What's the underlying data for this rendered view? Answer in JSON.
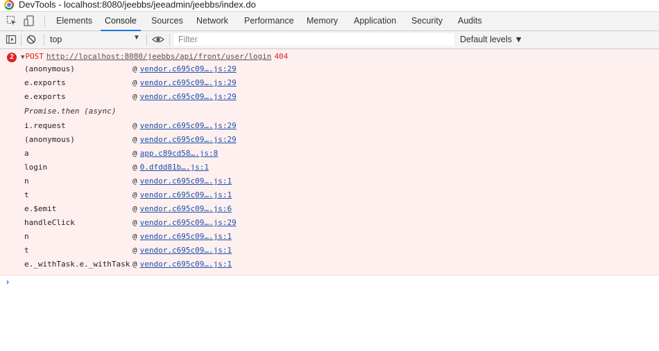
{
  "window": {
    "title": "DevTools - localhost:8080/jeebbs/jeeadmin/jeebbs/index.do"
  },
  "tabs": [
    {
      "label": "Elements"
    },
    {
      "label": "Console"
    },
    {
      "label": "Sources"
    },
    {
      "label": "Network"
    },
    {
      "label": "Performance"
    },
    {
      "label": "Memory"
    },
    {
      "label": "Application"
    },
    {
      "label": "Security"
    },
    {
      "label": "Audits"
    }
  ],
  "active_tab": "Console",
  "toolbar": {
    "context": "top",
    "filter_placeholder": "Filter",
    "levels": "Default levels ▼"
  },
  "error": {
    "count": "2",
    "method": "POST",
    "url": "http://localhost:8080/jeebbs/api/front/user/login",
    "status": "404",
    "frames": [
      {
        "fn": "(anonymous)",
        "at": "@",
        "src": "vendor.c695c09….js:29"
      },
      {
        "fn": "e.exports",
        "at": "@",
        "src": "vendor.c695c09….js:29"
      },
      {
        "fn": "e.exports",
        "at": "@",
        "src": "vendor.c695c09….js:29"
      },
      {
        "fn": "Promise.then (async)",
        "at": "",
        "src": ""
      },
      {
        "fn": "i.request",
        "at": "@",
        "src": "vendor.c695c09….js:29"
      },
      {
        "fn": "(anonymous)",
        "at": "@",
        "src": "vendor.c695c09….js:29"
      },
      {
        "fn": "a",
        "at": "@",
        "src": "app.c89cd58….js:8"
      },
      {
        "fn": "login",
        "at": "@",
        "src": "0.dfdd81b….js:1"
      },
      {
        "fn": "n",
        "at": "@",
        "src": "vendor.c695c09….js:1"
      },
      {
        "fn": "t",
        "at": "@",
        "src": "vendor.c695c09….js:1"
      },
      {
        "fn": "e.$emit",
        "at": "@",
        "src": "vendor.c695c09….js:6"
      },
      {
        "fn": "handleClick",
        "at": "@",
        "src": "vendor.c695c09….js:29"
      },
      {
        "fn": "n",
        "at": "@",
        "src": "vendor.c695c09….js:1"
      },
      {
        "fn": "t",
        "at": "@",
        "src": "vendor.c695c09….js:1"
      },
      {
        "fn": "e._withTask.e._withTask",
        "at": "@",
        "src": "vendor.c695c09….js:1"
      }
    ]
  },
  "prompt": "›",
  "colors": {
    "accent": "#1a73e8",
    "error": "#e0201e",
    "error_bg": "#fff0f0"
  }
}
